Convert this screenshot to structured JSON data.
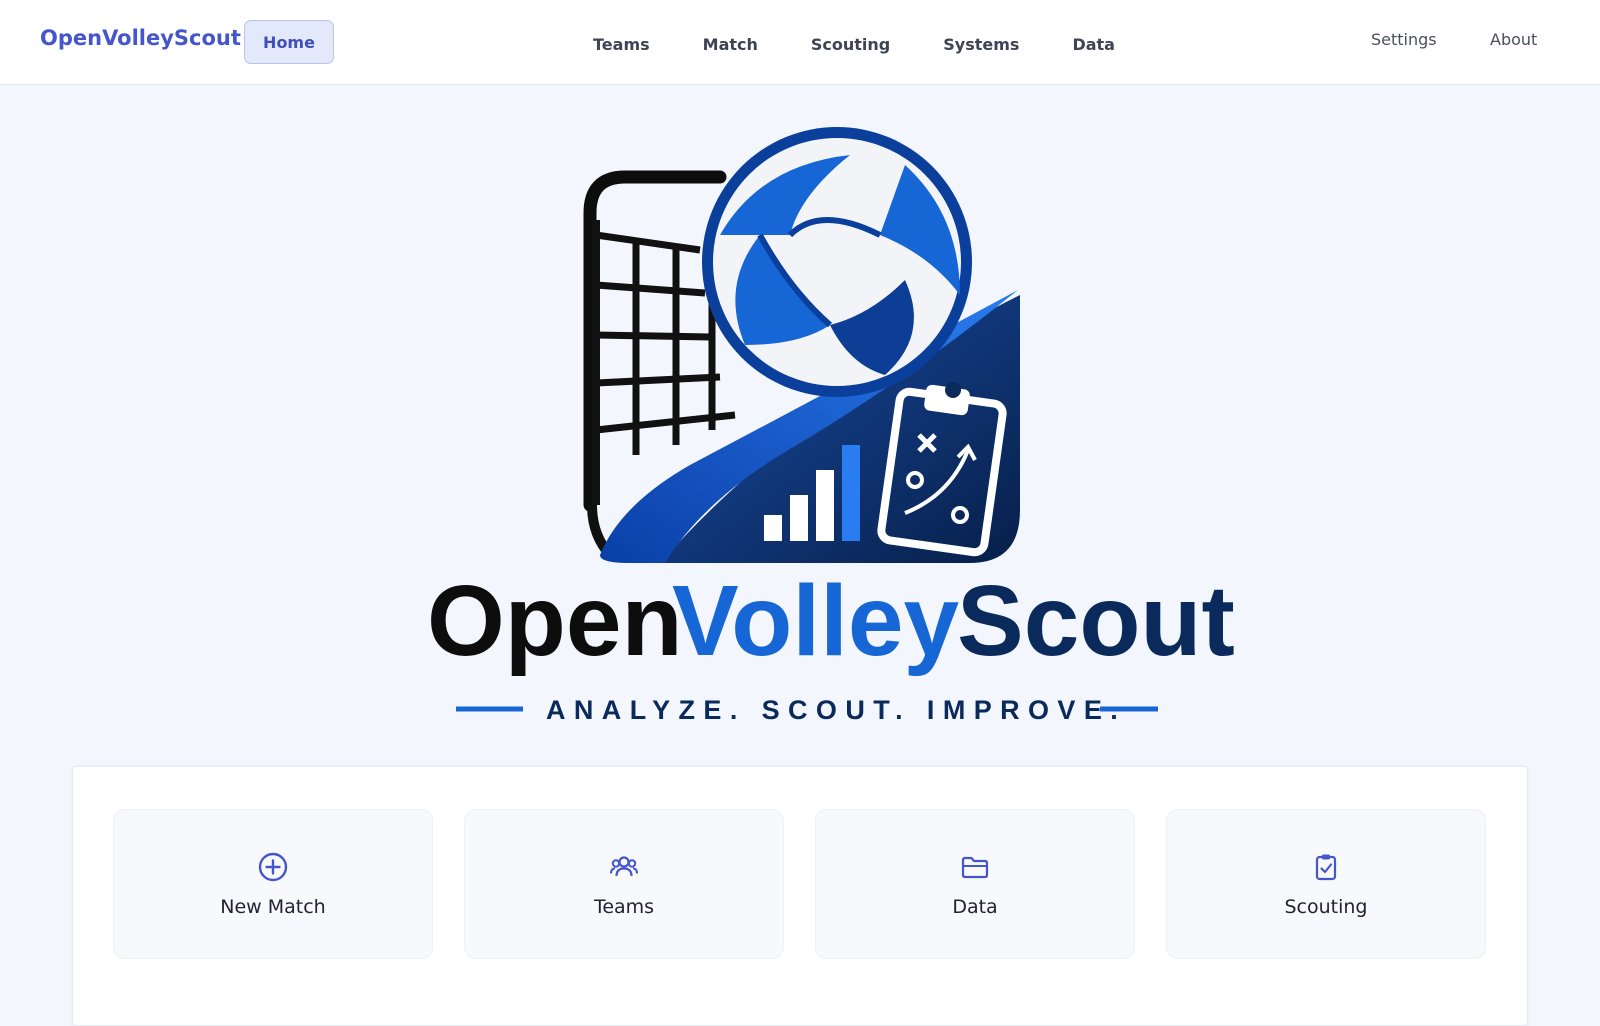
{
  "header": {
    "brand": "OpenVolleyScout",
    "home_label": "Home",
    "nav": [
      "Teams",
      "Match",
      "Scouting",
      "Systems",
      "Data"
    ],
    "right_nav": [
      "Settings",
      "About"
    ]
  },
  "hero": {
    "logo_word_1": "Open",
    "logo_word_2": "Volley",
    "logo_word_3": "Scout",
    "tagline": "ANALYZE. SCOUT. IMPROVE."
  },
  "cards": [
    {
      "label": "New Match",
      "icon": "plus-circle-icon"
    },
    {
      "label": "Teams",
      "icon": "users-icon"
    },
    {
      "label": "Data",
      "icon": "folder-icon"
    },
    {
      "label": "Scouting",
      "icon": "clipboard-check-icon"
    }
  ],
  "colors": {
    "brand": "#4556cc",
    "home_button_bg": "#e3e8fb",
    "page_bg": "#f3f6fc",
    "logo_navy": "#0b2a5c",
    "logo_blue": "#1766d6"
  }
}
